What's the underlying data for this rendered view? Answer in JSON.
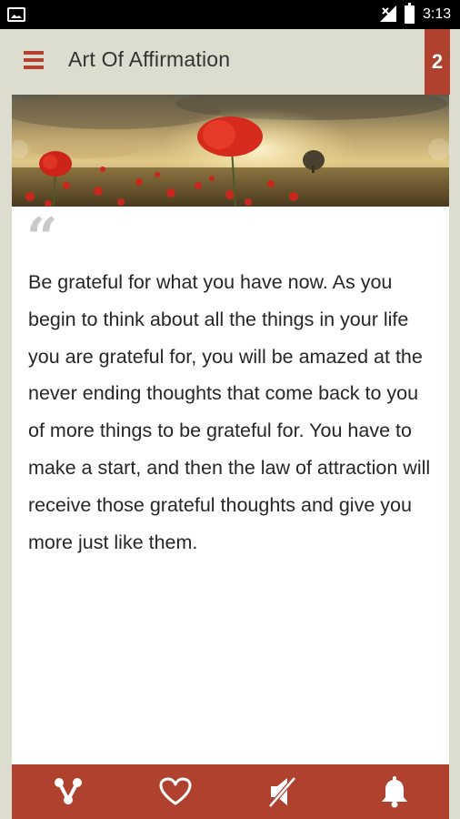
{
  "status_bar": {
    "time": "3:13"
  },
  "app_bar": {
    "title": "Art Of Affirmation",
    "page_number": "2"
  },
  "card": {
    "quote": "Be grateful for what you have now. As you begin to think about all the things in your life you are grateful for, you will be amazed at the never ending thoughts that come back to you of more things to be grateful for. You have to make a start, and then the law of attraction will receive those grateful thoughts and give you more just like them."
  },
  "bottom_bar": {
    "icons": [
      "share-icon",
      "heart-icon",
      "sound-off-icon",
      "bell-icon"
    ]
  },
  "colors": {
    "accent": "#b0412e",
    "background": "#dcdccf",
    "card": "#ffffff",
    "text": "#262626"
  }
}
